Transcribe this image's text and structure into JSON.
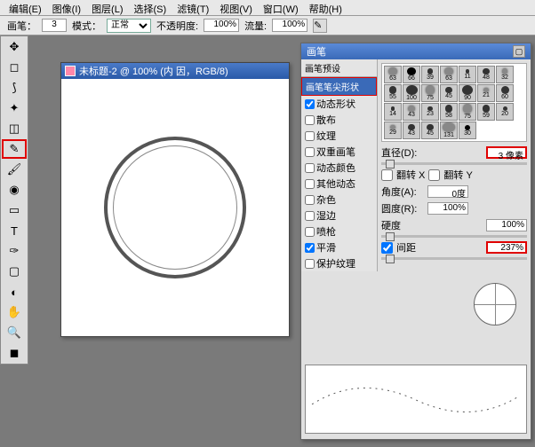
{
  "menubar": [
    "编辑(E)",
    "图像(I)",
    "图层(L)",
    "选择(S)",
    "滤镜(T)",
    "视图(V)",
    "窗口(W)",
    "帮助(H)"
  ],
  "options": {
    "brush_label": "画笔：",
    "brush_size": "3",
    "mode_label": "模式：",
    "mode_value": "正常",
    "opacity_label": "不透明度:",
    "opacity_value": "100%",
    "flow_label": "流量:",
    "flow_value": "100%"
  },
  "doc": {
    "title": "未标题-2 @ 100% (内 因，RGB/8)"
  },
  "palette": {
    "title": "画笔",
    "tab_preset": "画笔预设",
    "tab_shape": "画笔笔尖形状",
    "opts": [
      {
        "label": "动态形状",
        "checked": true
      },
      {
        "label": "散布",
        "checked": false
      },
      {
        "label": "纹理",
        "checked": false
      },
      {
        "label": "双重画笔",
        "checked": false
      },
      {
        "label": "动态颜色",
        "checked": false
      },
      {
        "label": "其他动态",
        "checked": false
      },
      {
        "label": "杂色",
        "checked": false
      },
      {
        "label": "湿边",
        "checked": false
      },
      {
        "label": "喷枪",
        "checked": false
      },
      {
        "label": "平滑",
        "checked": true
      },
      {
        "label": "保护纹理",
        "checked": false
      }
    ],
    "swatches": [
      "63",
      "66",
      "39",
      "63",
      "11",
      "48",
      "32",
      "55",
      "100",
      "75",
      "45",
      "90",
      "21",
      "60",
      "14",
      "43",
      "23",
      "58",
      "75",
      "59",
      "20",
      "29",
      "43",
      "45",
      "131",
      "30"
    ],
    "diameter_label": "直径(D):",
    "diameter_value": "3 像素",
    "flipx": "翻转 X",
    "flipy": "翻转 Y",
    "angle_label": "角度(A):",
    "angle_value": "0度",
    "roundness_label": "圆度(R):",
    "roundness_value": "100%",
    "hardness_label": "硬度",
    "hardness_value": "100%",
    "spacing_label": "间距",
    "spacing_value": "237%"
  }
}
